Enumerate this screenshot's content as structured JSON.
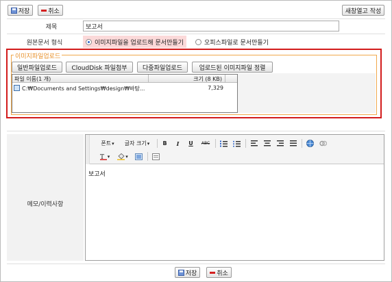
{
  "top_toolbar": {
    "save_label": "저장",
    "cancel_label": "취소",
    "create_report_label": "새창열고 작성"
  },
  "form": {
    "title_label": "제목",
    "title_value": "보고서",
    "source_format_label": "원본문서 형식",
    "source_options": [
      {
        "label": "이미지파일을 업로드해 문서만들기",
        "selected": true
      },
      {
        "label": "오피스파일로 문서만들기",
        "selected": false
      }
    ],
    "memo_label": "메모/이력사항"
  },
  "upload": {
    "legend": "이미지파일업로드",
    "buttons": [
      "일반파일업로드",
      "CloudDisk 파일첨부",
      "다중파일업로드",
      "업로드된 이미지파일 정렬"
    ],
    "list_header_name": "파일 이름(1 개)",
    "list_header_size": "크기 (8 KB)",
    "files": [
      {
        "name": "C:₩Documents and Settings₩design₩바탕...",
        "size": "7,329"
      }
    ]
  },
  "editor": {
    "font_label": "폰트",
    "font_size_label": "글자 크기",
    "bold": "B",
    "italic": "I",
    "underline": "U",
    "strike": "ABC",
    "content": "보고서"
  },
  "bottom_toolbar": {
    "save_label": "저장",
    "cancel_label": "취소"
  },
  "colors": {
    "upload_border": "#d21a1a",
    "legend": "#e8902a",
    "radio_highlight": "#fbd9d9",
    "cancel_icon": "#d42020",
    "save_icon": "#6f93d6"
  }
}
